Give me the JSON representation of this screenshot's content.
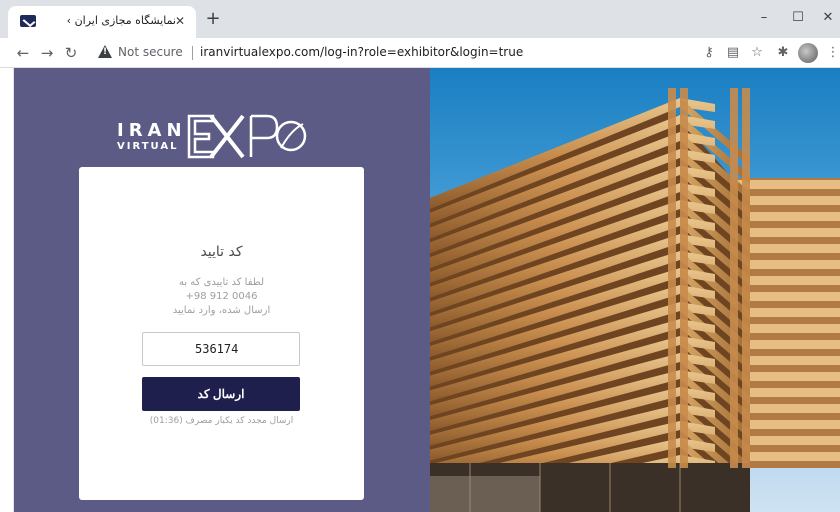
{
  "browser": {
    "tab_title": "نمایشگاه مجازی ایران › ورود",
    "tab_close": "✕",
    "new_tab": "+",
    "window_buttons": {
      "minimize": "–",
      "maximize": "☐",
      "close": "✕"
    },
    "not_secure_label": "Not secure",
    "url": "iranvirtualexpo.com/log-in?role=exhibitor&login=true",
    "icons": [
      "back-icon",
      "forward-icon",
      "reload-icon",
      "key-icon",
      "translate-icon",
      "star-icon",
      "extensions-icon",
      "profile-icon",
      "menu-icon"
    ]
  },
  "logo": {
    "line1": "IRAN",
    "line2": "VIRTUAL",
    "brand": "EXPO"
  },
  "verify": {
    "title": "کد تایید",
    "message_line1": "لطفا کد تاییدی که به",
    "message_line2": "+98 912        0046",
    "message_line3": "ارسال شده، وارد نمایید",
    "code_value": "536174",
    "submit_label": "ارسال کد",
    "resend_text": "ارسال مجدد کد یکبار مصرف (01:36)"
  },
  "colors": {
    "left_panel": "#5c5b86",
    "button": "#1f1f4e",
    "card": "#ffffff"
  }
}
